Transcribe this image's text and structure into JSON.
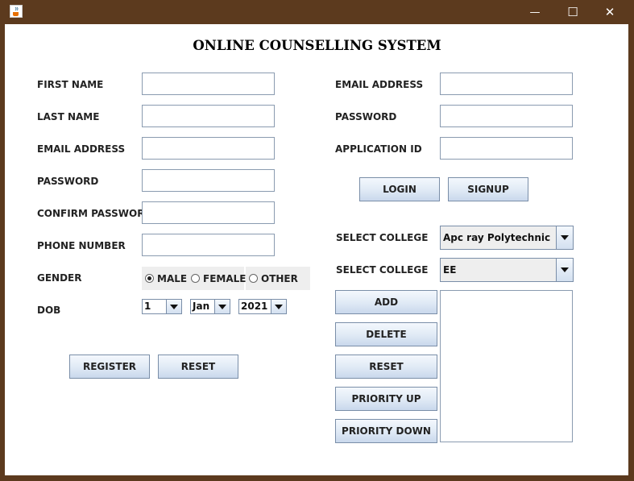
{
  "window": {
    "minimize_glyph": "—",
    "maximize_glyph": "☐",
    "close_glyph": "✕"
  },
  "heading": "ONLINE COUNSELLING SYSTEM",
  "register": {
    "first_name_label": "FIRST NAME",
    "last_name_label": "LAST NAME",
    "email_label": "EMAIL ADDRESS",
    "password_label": "PASSWORD",
    "confirm_password_label": "CONFIRM PASSWORD",
    "phone_label": "PHONE NUMBER",
    "gender_label": "GENDER",
    "gender_options": [
      "MALE",
      "FEMALE",
      "OTHER"
    ],
    "gender_selected": "MALE",
    "dob_label": "DOB",
    "dob_day": "1",
    "dob_month": "Jan",
    "dob_year": "2021",
    "register_button": "REGISTER",
    "reset_button": "RESET"
  },
  "login": {
    "email_label": "EMAIL ADDRESS",
    "password_label": "PASSWORD",
    "application_id_label": "APPLICATION ID",
    "login_button": "LOGIN",
    "signup_button": "SIGNUP"
  },
  "college": {
    "select_college_label_1": "SELECT COLLEGE",
    "select_college_label_2": "SELECT COLLEGE",
    "college_selected": "Apc ray Polytechnic",
    "branch_selected": "EE",
    "add_button": "ADD",
    "delete_button": "DELETE",
    "reset_button": "RESET",
    "priority_up_button": "PRIORITY UP",
    "priority_down_button": "PRIORITY DOWN",
    "choices": []
  },
  "colors": {
    "titlebar": "#5c3a1e",
    "button_border": "#7a8ea8",
    "field_border": "#8a9bb0"
  },
  "icons": {
    "app": "java-cup-icon",
    "minimize": "minimize-icon",
    "maximize": "maximize-icon",
    "close": "close-icon",
    "dropdown": "chevron-down-icon"
  }
}
